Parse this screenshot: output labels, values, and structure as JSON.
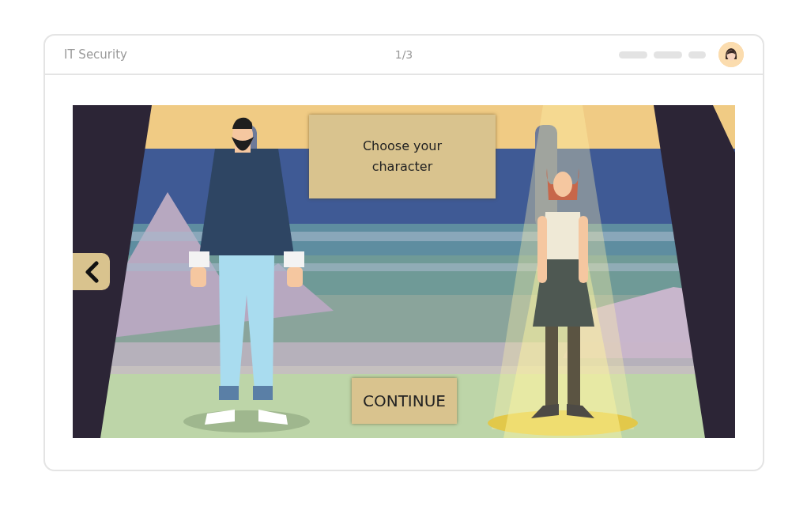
{
  "header": {
    "title": "IT Security",
    "page_counter": "1/3"
  },
  "scene": {
    "prompt": "Choose your\ncharacter",
    "continue_label": "CONTINUE",
    "characters": [
      {
        "kind": "man",
        "selected": false
      },
      {
        "kind": "woman",
        "selected": true
      }
    ]
  }
}
